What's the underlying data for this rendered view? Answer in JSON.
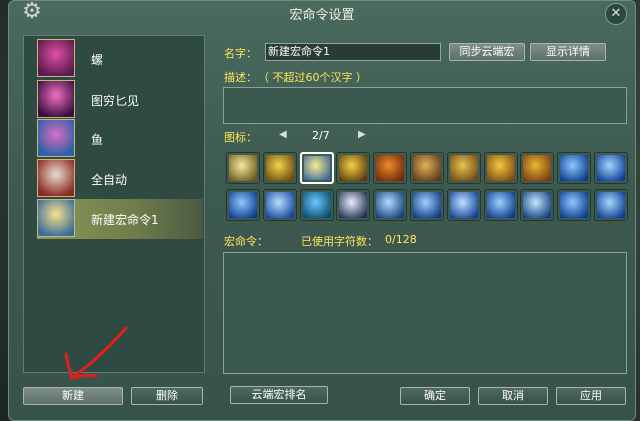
{
  "window": {
    "title": "宏命令设置"
  },
  "macro_list": [
    {
      "label": "螺",
      "icon": "pink-flower-skill-icon",
      "colors": [
        "#e14da6",
        "#5a1b4a"
      ]
    },
    {
      "label": "图穷匕见",
      "icon": "pink-shadow-skill-icon",
      "colors": [
        "#f06fc0",
        "#3a1040"
      ]
    },
    {
      "label": "鱼",
      "icon": "blue-pink-fish-skill-icon",
      "colors": [
        "#d86fc0",
        "#2b5fa8"
      ]
    },
    {
      "label": "全自动",
      "icon": "red-bowl-skill-icon",
      "colors": [
        "#e6e0d0",
        "#8e2a22"
      ]
    },
    {
      "label": "新建宏命令1",
      "icon": "golden-monk-skill-icon",
      "colors": [
        "#f7e38a",
        "#3c6c9a"
      ],
      "selected": true
    }
  ],
  "buttons": {
    "new": "新建",
    "delete": "删除",
    "cloud_rank": "云端宏排名",
    "confirm": "确定",
    "cancel": "取消",
    "apply": "应用",
    "sync_cloud": "同步云端宏",
    "show_details": "显示详情"
  },
  "form": {
    "name_label": "名字：",
    "name_value": "新建宏命令1",
    "desc_label": "描述：",
    "desc_hint": "（ 不超过60个汉字 ）",
    "icons_label": "图标：",
    "page_indicator": "2/7",
    "cmd_label": "宏命令：",
    "char_count_label": "已使用字符数：",
    "char_count_value": "0/128"
  },
  "icons_row1": [
    {
      "name": "monk-black-skill-icon",
      "c1": "#f4e9a0",
      "c2": "#6b5a1a"
    },
    {
      "name": "golden-statue-skill-icon",
      "c1": "#f1d44a",
      "c2": "#6b4a10"
    },
    {
      "name": "golden-monk-skill-icon",
      "c1": "#fbe98c",
      "c2": "#3c6c9a",
      "selected": true
    },
    {
      "name": "golden-staff-skill-icon",
      "c1": "#f5d24a",
      "c2": "#5a3a08"
    },
    {
      "name": "orange-fist-skill-icon",
      "c1": "#f08a2a",
      "c2": "#6a2a08"
    },
    {
      "name": "bronze-head-skill-icon",
      "c1": "#e3b05a",
      "c2": "#5a3a18"
    },
    {
      "name": "golden-blade-skill-icon",
      "c1": "#e9c24a",
      "c2": "#6a4a18"
    },
    {
      "name": "golden-warrior-skill-icon",
      "c1": "#f5c840",
      "c2": "#7a4a12"
    },
    {
      "name": "golden-mask-skill-icon",
      "c1": "#e8b830",
      "c2": "#7a3a10"
    },
    {
      "name": "blue-slash-skill-icon",
      "c1": "#8cc8ff",
      "c2": "#0a3a8a"
    },
    {
      "name": "blue-claw-skill-icon",
      "c1": "#a4d4ff",
      "c2": "#0b3c94"
    }
  ],
  "icons_row2": [
    {
      "name": "blue-strike-skill-icon",
      "c1": "#8ec8ff",
      "c2": "#0c3a88"
    },
    {
      "name": "blue-burst-skill-icon",
      "c1": "#b8e0ff",
      "c2": "#1446a0"
    },
    {
      "name": "blue-swirl-skill-icon",
      "c1": "#6ac8ff",
      "c2": "#0a4a6a"
    },
    {
      "name": "dark-figure-skill-icon",
      "c1": "#e8eef8",
      "c2": "#203050"
    },
    {
      "name": "blue-runner-skill-icon",
      "c1": "#b0dcff",
      "c2": "#14407a"
    },
    {
      "name": "blue-wave-skill-icon",
      "c1": "#a0d0ff",
      "c2": "#0e3a84"
    },
    {
      "name": "blue-meditate-skill-icon",
      "c1": "#bde2ff",
      "c2": "#12409a"
    },
    {
      "name": "blue-leap-skill-icon",
      "c1": "#9ed0ff",
      "c2": "#0d3b8c"
    },
    {
      "name": "blue-dash-skill-icon",
      "c1": "#c4e6ff",
      "c2": "#123e7c"
    },
    {
      "name": "blue-arrows-skill-icon",
      "c1": "#8ec8ff",
      "c2": "#0b3a8c"
    },
    {
      "name": "blue-wind-skill-icon",
      "c1": "#a8d8ff",
      "c2": "#0c3c90"
    }
  ],
  "colors": {
    "accent_yellow": "#ffe55b",
    "annotation_red": "#e0201a"
  }
}
